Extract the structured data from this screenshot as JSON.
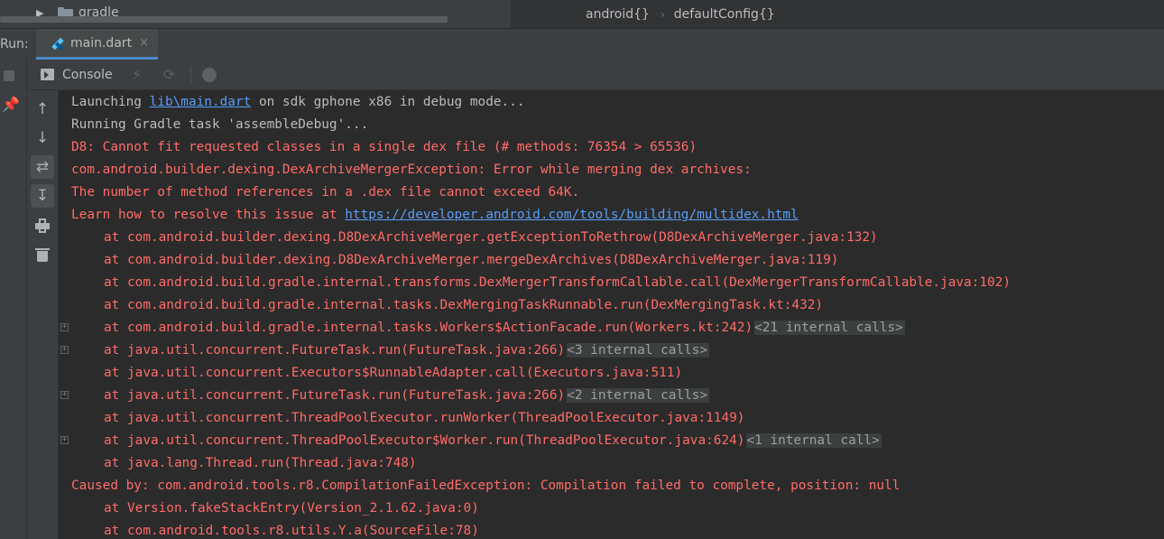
{
  "project_tree": {
    "folder_label": "gradle"
  },
  "editor_breadcrumb": {
    "items": [
      "android{}",
      "defaultConfig{}"
    ]
  },
  "run_panel": {
    "label": "Run:",
    "tab_label": "main.dart",
    "close_glyph": "×"
  },
  "console_toolbar": {
    "console_label": "Console",
    "icons": [
      "console-icon",
      "hot-reload-icon",
      "hot-restart-icon",
      "open-devtools-icon"
    ]
  },
  "side_tools": [
    "stop-icon",
    "pin-icon",
    "up-arrow-icon",
    "down-arrow-icon",
    "soft-wrap-icon",
    "scroll-to-end-icon",
    "print-icon",
    "trash-icon"
  ],
  "console": {
    "lines": [
      {
        "type": "normal",
        "prefix": "Launching ",
        "link": "lib\\main.dart",
        "suffix": " on sdk gphone x86 in debug mode..."
      },
      {
        "type": "normal",
        "text": "Running Gradle task 'assembleDebug'..."
      },
      {
        "type": "error",
        "text": "D8: Cannot fit requested classes in a single dex file (# methods: 76354 > 65536)"
      },
      {
        "type": "error",
        "text": "com.android.builder.dexing.DexArchiveMergerException: Error while merging dex archives:"
      },
      {
        "type": "error",
        "text": "The number of method references in a .dex file cannot exceed 64K."
      },
      {
        "type": "error",
        "prefix": "Learn how to resolve this issue at ",
        "link": "https://developer.android.com/tools/building/multidex.html"
      },
      {
        "type": "error-indent",
        "text": "at com.android.builder.dexing.D8DexArchiveMerger.getExceptionToRethrow(D8DexArchiveMerger.java:132)"
      },
      {
        "type": "error-indent",
        "text": "at com.android.builder.dexing.D8DexArchiveMerger.mergeDexArchives(D8DexArchiveMerger.java:119)"
      },
      {
        "type": "error-indent",
        "text": "at com.android.build.gradle.internal.transforms.DexMergerTransformCallable.call(DexMergerTransformCallable.java:102)"
      },
      {
        "type": "error-indent",
        "text": "at com.android.build.gradle.internal.tasks.DexMergingTaskRunnable.run(DexMergingTask.kt:432)"
      },
      {
        "type": "error-indent",
        "text": "at com.android.build.gradle.internal.tasks.Workers$ActionFacade.run(Workers.kt:242)",
        "fold": "<21 internal calls>"
      },
      {
        "type": "error-indent",
        "text": "at java.util.concurrent.FutureTask.run(FutureTask.java:266)",
        "fold": "<3 internal calls>"
      },
      {
        "type": "error-indent",
        "text": "at java.util.concurrent.Executors$RunnableAdapter.call(Executors.java:511)"
      },
      {
        "type": "error-indent",
        "text": "at java.util.concurrent.FutureTask.run(FutureTask.java:266)",
        "fold": "<2 internal calls>"
      },
      {
        "type": "error-indent",
        "text": "at java.util.concurrent.ThreadPoolExecutor.runWorker(ThreadPoolExecutor.java:1149)"
      },
      {
        "type": "error-indent",
        "text": "at java.util.concurrent.ThreadPoolExecutor$Worker.run(ThreadPoolExecutor.java:624)",
        "fold": "<1 internal call>"
      },
      {
        "type": "error-indent",
        "text": "at java.lang.Thread.run(Thread.java:748)"
      },
      {
        "type": "error",
        "text": "Caused by: com.android.tools.r8.CompilationFailedException: Compilation failed to complete, position: null"
      },
      {
        "type": "error-indent",
        "text": "at Version.fakeStackEntry(Version_2.1.62.java:0)"
      },
      {
        "type": "error-indent",
        "text": "at com.android.tools.r8.utils.Y.a(SourceFile:78)"
      }
    ]
  },
  "colors": {
    "background": "#2b2b2b",
    "panel": "#3c3f41",
    "error_text": "#ff6b68",
    "normal_text": "#bbbbbb",
    "link": "#589df6",
    "tab_underline": "#4a88c7"
  }
}
